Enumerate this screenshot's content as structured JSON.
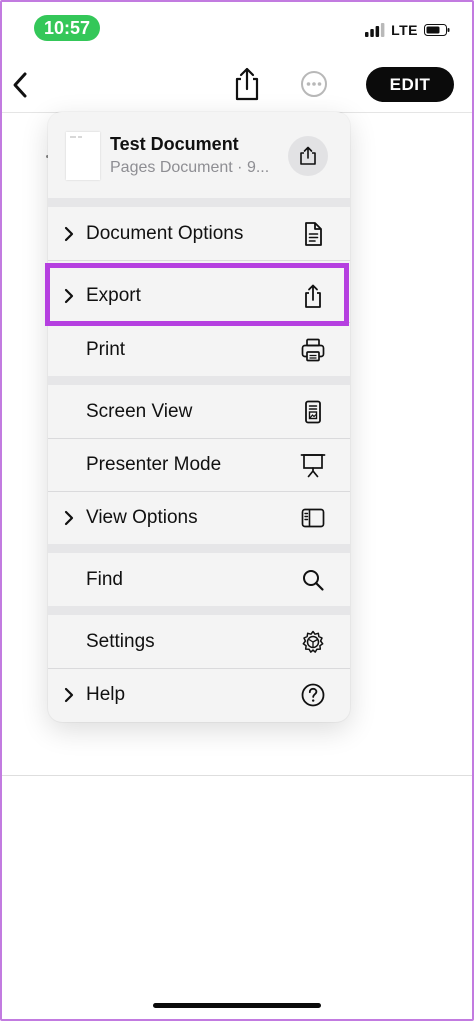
{
  "status_bar": {
    "time": "10:57",
    "network": "LTE"
  },
  "nav": {
    "edit_label": "EDIT"
  },
  "menu": {
    "document": {
      "title": "Test Document",
      "subtitle": "Pages Document · 9..."
    },
    "items": [
      {
        "label": "Document Options",
        "chevron": true,
        "icon": "document-icon"
      },
      {
        "label": "Export",
        "chevron": true,
        "icon": "share-icon",
        "highlighted": true
      },
      {
        "label": "Print",
        "chevron": false,
        "icon": "printer-icon"
      },
      {
        "label": "Screen View",
        "chevron": false,
        "icon": "screen-view-icon"
      },
      {
        "label": "Presenter Mode",
        "chevron": false,
        "icon": "presenter-icon"
      },
      {
        "label": "View Options",
        "chevron": true,
        "icon": "sidebar-icon"
      },
      {
        "label": "Find",
        "chevron": false,
        "icon": "magnifier-icon"
      },
      {
        "label": "Settings",
        "chevron": false,
        "icon": "gear-icon"
      },
      {
        "label": "Help",
        "chevron": true,
        "icon": "question-icon"
      }
    ]
  },
  "colors": {
    "highlight": "#b53fe0",
    "time_pill": "#34c759",
    "frame": "#c27be0"
  }
}
